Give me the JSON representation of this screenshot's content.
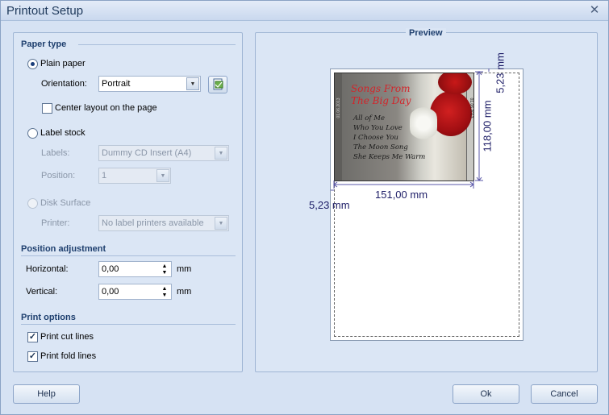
{
  "window": {
    "title": "Printout Setup",
    "close_symbol": "✕"
  },
  "paper_type": {
    "header": "Paper type",
    "plain_paper": "Plain paper",
    "orientation_label": "Orientation:",
    "orientation_value": "Portrait",
    "center_layout": "Center layout on the page",
    "label_stock": "Label stock",
    "labels_label": "Labels:",
    "labels_value": "Dummy CD Insert (A4)",
    "position_label": "Position:",
    "position_value": "1",
    "disk_surface": "Disk Surface",
    "printer_label": "Printer:",
    "printer_value": "No label printers available"
  },
  "position_adjustment": {
    "header": "Position adjustment",
    "horizontal_label": "Horizontal:",
    "horizontal_value": "0,00",
    "vertical_label": "Vertical:",
    "vertical_value": "0,00",
    "unit": "mm"
  },
  "print_options": {
    "header": "Print options",
    "cut_lines": "Print cut lines",
    "fold_lines": "Print fold lines",
    "check_mark": "✓"
  },
  "preview": {
    "header": "Preview",
    "width_dim": "151,00 mm",
    "height_dim": "118,00 mm",
    "top_margin": "5,23 mm",
    "left_margin": "5,23 mm",
    "cover_title_1": "Songs From",
    "cover_title_2": "The Big Day",
    "tracks": [
      "All of Me",
      "Who You Love",
      "I Choose You",
      "The Moon Song",
      "She Keeps Me Warm"
    ],
    "spine_text": "01.06.2013"
  },
  "buttons": {
    "help": "Help",
    "ok": "Ok",
    "cancel": "Cancel"
  }
}
